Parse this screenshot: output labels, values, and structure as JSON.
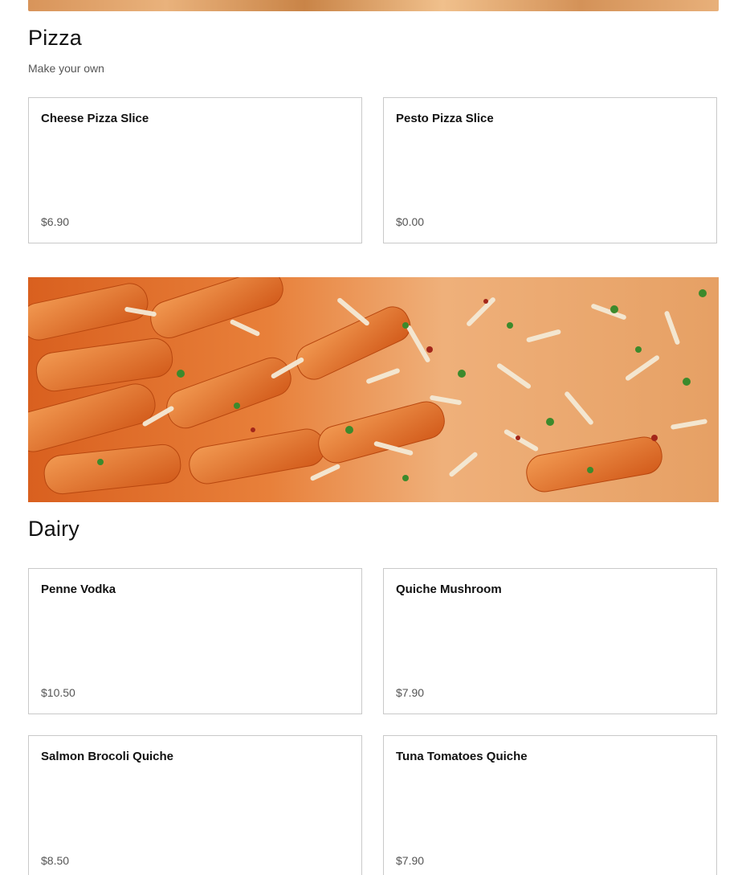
{
  "sections": [
    {
      "title": "Pizza",
      "subtitle": "Make your own",
      "items": [
        {
          "name": "Cheese Pizza Slice",
          "price": "$6.90"
        },
        {
          "name": "Pesto Pizza Slice",
          "price": "$0.00"
        }
      ]
    },
    {
      "title": "Dairy",
      "items": [
        {
          "name": "Penne Vodka",
          "price": "$10.50"
        },
        {
          "name": "Quiche Mushroom",
          "price": "$7.90"
        },
        {
          "name": "Salmon Brocoli Quiche",
          "price": "$8.50"
        },
        {
          "name": "Tuna Tomatoes Quiche",
          "price": "$7.90"
        }
      ]
    }
  ],
  "colors": {
    "card_border": "#c9c9c9",
    "price_text": "#555555",
    "title_text": "#111111"
  },
  "images": {
    "top_banner": "pizza-crust-image",
    "section_banner": "penne-pasta-with-parmesan-image"
  }
}
